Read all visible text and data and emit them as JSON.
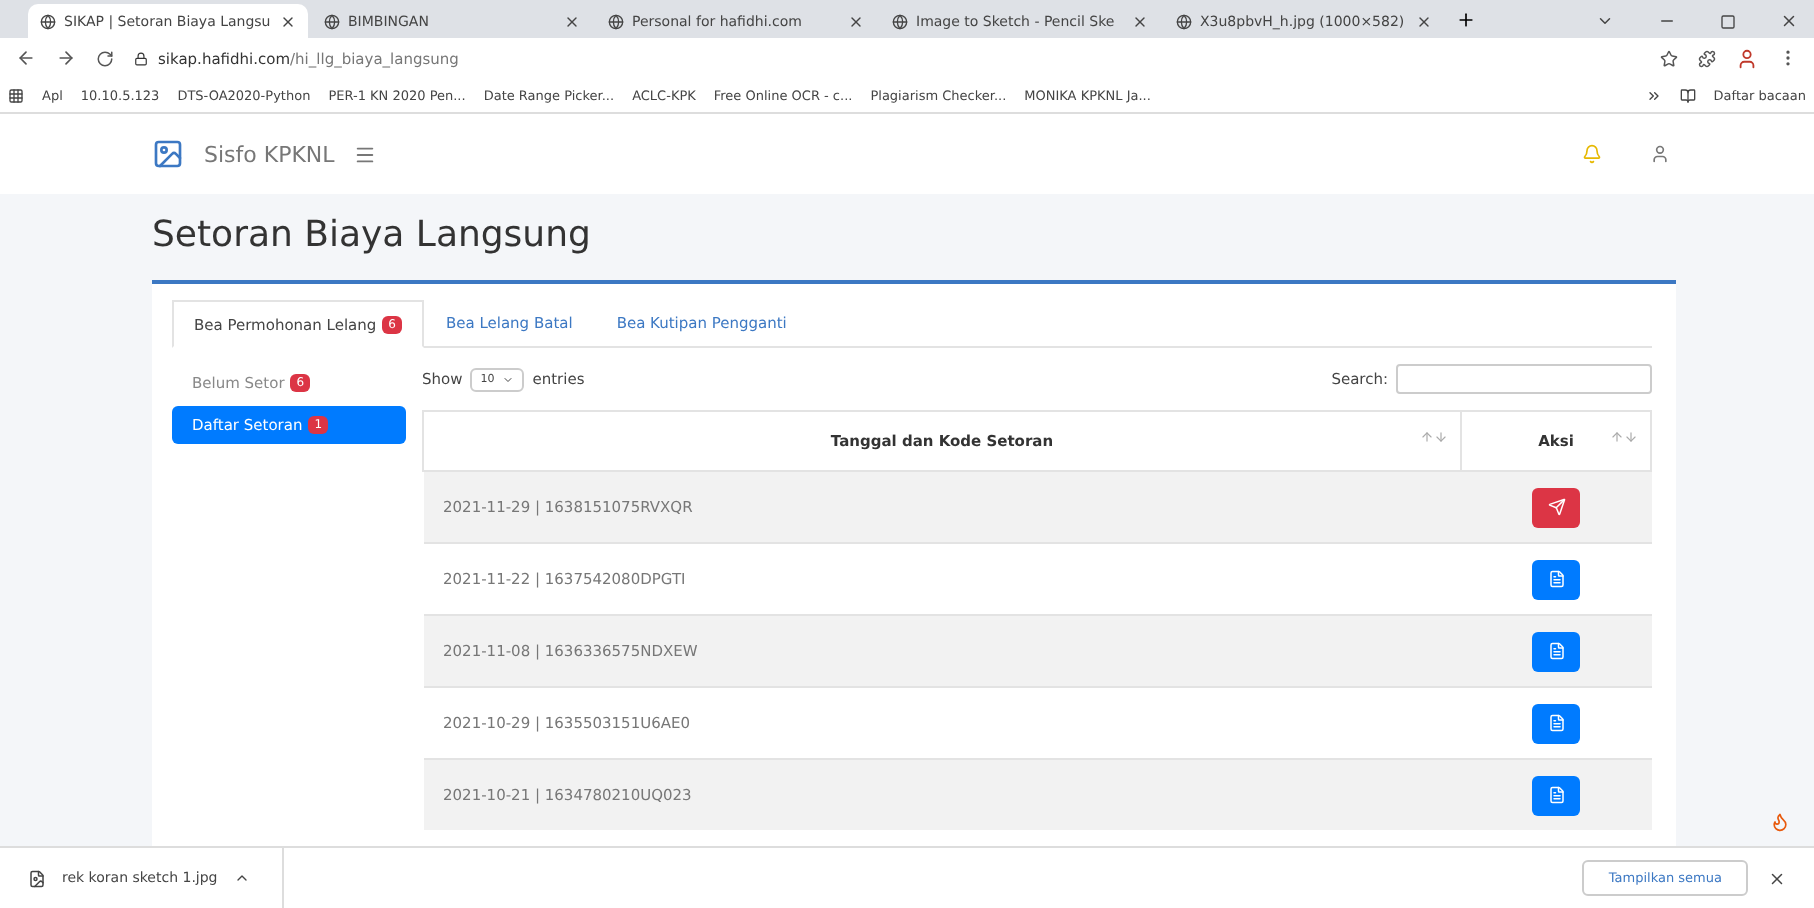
{
  "browser": {
    "tabs": [
      {
        "title": "SIKAP | Setoran Biaya Langsu",
        "selected": true
      },
      {
        "title": "BIMBINGAN",
        "selected": false
      },
      {
        "title": "Personal for hafidhi.com",
        "selected": false
      },
      {
        "title": "Image to Sketch - Pencil Ske",
        "selected": false
      },
      {
        "title": "X3u8pbvH_h.jpg (1000×582)",
        "selected": false
      }
    ],
    "address": {
      "host": "sikap.hafidhi.com",
      "path": "/hi_llg_biaya_langsung"
    },
    "bookmarks": [
      "Apl",
      "10.10.5.123",
      "DTS-OA2020-Python",
      "PER-1 KN 2020 Pen...",
      "Date Range Picker...",
      "ACLC-KPK",
      "Free Online OCR - c...",
      "Plagiarism Checker...",
      "MONIKA KPKNL Ja..."
    ],
    "reading_list": "Daftar bacaan"
  },
  "app": {
    "brand": "Sisfo KPKNL",
    "page_title": "Setoran Biaya Langsung",
    "main_tabs": [
      {
        "label": "Bea Permohonan Lelang",
        "badge": "6",
        "selected": true
      },
      {
        "label": "Bea Lelang Batal",
        "selected": false
      },
      {
        "label": "Bea Kutipan Pengganti",
        "selected": false
      }
    ],
    "side_nav": [
      {
        "label": "Belum Setor",
        "badge": "6",
        "selected": false
      },
      {
        "label": "Daftar Setoran",
        "badge": "1",
        "selected": true
      }
    ],
    "table": {
      "show_label": "Show",
      "page_size": "10",
      "entries_label": "entries",
      "search_label": "Search:",
      "columns": [
        "Tanggal dan Kode Setoran",
        "Aksi"
      ],
      "rows": [
        {
          "text": "2021-11-29 | 1638151075RVXQR",
          "kind": "send"
        },
        {
          "text": "2021-11-22 | 1637542080DPGTI",
          "kind": "document"
        },
        {
          "text": "2021-11-08 | 1636336575NDXEW",
          "kind": "document"
        },
        {
          "text": "2021-10-29 | 1635503151U6AE0",
          "kind": "document"
        },
        {
          "text": "2021-10-21 | 1634780210UQ023",
          "kind": "document"
        }
      ]
    }
  },
  "downloads": {
    "file": "rek koran sketch 1.jpg",
    "show_all": "Tampilkan semua"
  }
}
